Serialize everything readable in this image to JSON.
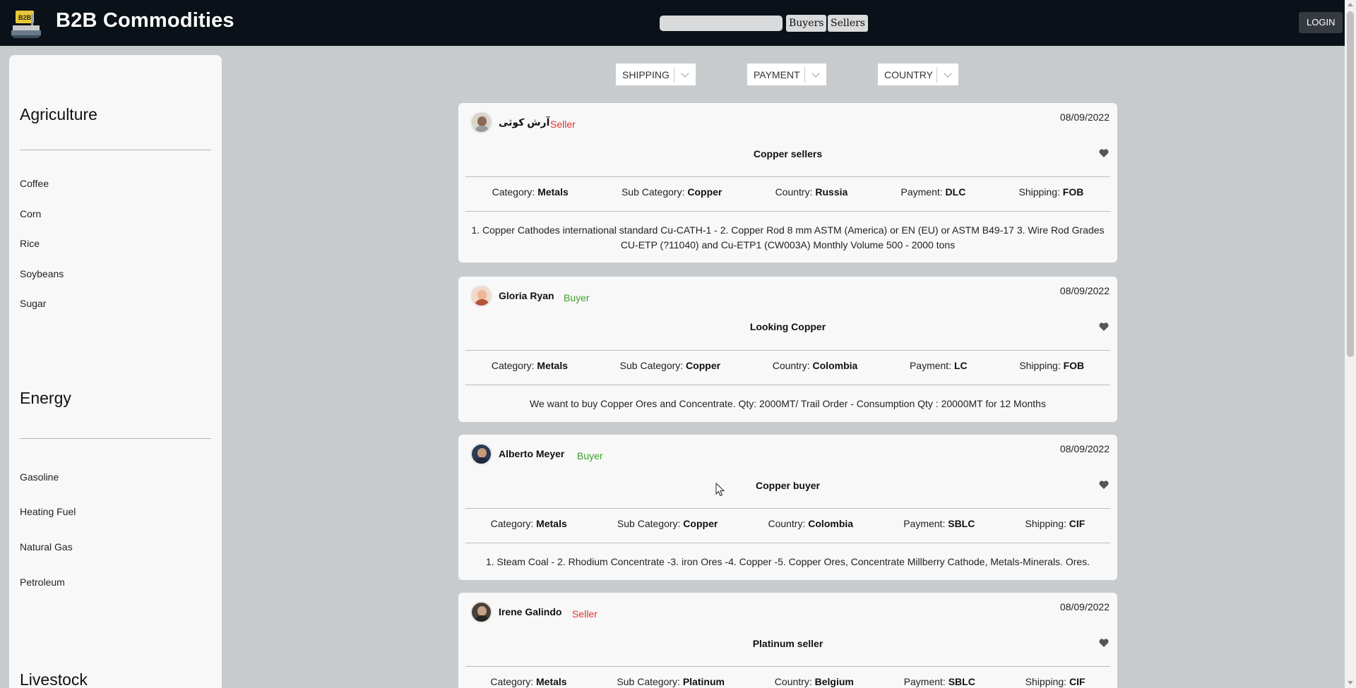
{
  "header": {
    "brand": "B2B Commodities",
    "logo_text": "B2B",
    "search": {
      "placeholder": "",
      "value": ""
    },
    "buyers_label": "Buyers",
    "sellers_label": "Sellers",
    "login_label": "LOGIN"
  },
  "sidebar": {
    "agriculture": {
      "title": "Agriculture",
      "items": [
        "Coffee",
        "Corn",
        "Rice",
        "Soybeans",
        "Sugar"
      ]
    },
    "energy": {
      "title": "Energy",
      "items": [
        "Gasoline",
        "Heating Fuel",
        "Natural Gas",
        "Petroleum"
      ]
    },
    "livestock": {
      "title": "Livestock"
    }
  },
  "filters": {
    "shipping": "SHIPPING",
    "payment": "PAYMENT",
    "country": "COUNTRY"
  },
  "labels": {
    "category": "Category:",
    "sub_category": "Sub Category:",
    "country": "Country:",
    "payment": "Payment:",
    "shipping": "Shipping:"
  },
  "posts": [
    {
      "user": "آرش کوثی",
      "role": "Seller",
      "date": "08/09/2022",
      "title": "Copper sellers",
      "category": "Metals",
      "sub_category": "Copper",
      "country": "Russia",
      "payment": "DLC",
      "shipping": "FOB",
      "description": "1. Copper Cathodes international standard Cu-CATH-1 - 2. Copper Rod 8 mm ASTM (America) or EN (EU) or ASTM B49-17 3. Wire Rod Grades CU-ETP (?11040) and Cu-ETP1 (CW003A) Monthly Volume 500 - 2000 tons"
    },
    {
      "user": "Gloria Ryan",
      "role": "Buyer",
      "date": "08/09/2022",
      "title": "Looking Copper",
      "category": "Metals",
      "sub_category": "Copper",
      "country": "Colombia",
      "payment": "LC",
      "shipping": "FOB",
      "description": "We want to buy Copper Ores and Concentrate. Qty: 2000MT/ Trail Order - Consumption Qty : 20000MT for 12 Months"
    },
    {
      "user": "Alberto Meyer",
      "role": "Buyer",
      "date": "08/09/2022",
      "title": "Copper buyer",
      "category": "Metals",
      "sub_category": "Copper",
      "country": "Colombia",
      "payment": "SBLC",
      "shipping": "CIF",
      "description": "1. Steam Coal - 2. Rhodium Concentrate -3. iron Ores -4. Copper -5. Copper Ores, Concentrate Millberry Cathode, Metals-Minerals. Ores."
    },
    {
      "user": "Irene Galindo",
      "role": "Seller",
      "date": "08/09/2022",
      "title": "Platinum seller",
      "category": "Metals",
      "sub_category": "Platinum",
      "country": "Belgium",
      "payment": "SBLC",
      "shipping": "CIF",
      "description": ""
    }
  ],
  "colors": {
    "header_bg": "#0b1118",
    "page_bg": "#c7cbcd",
    "seller": "#e0322f",
    "buyer": "#3f9e2f"
  },
  "icons": [
    "logo-icon",
    "chevron-down-icon",
    "heart-icon",
    "avatar",
    "mouse-cursor-icon"
  ]
}
